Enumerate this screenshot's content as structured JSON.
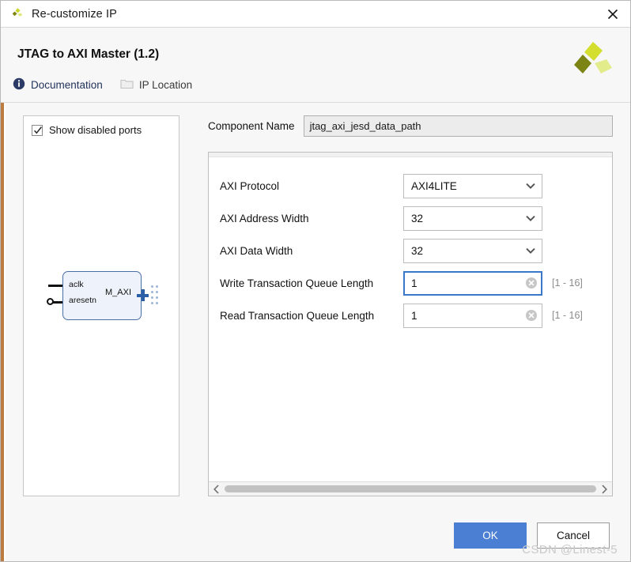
{
  "window": {
    "title": "Re-customize IP",
    "close_label": "×",
    "logo_icon": "xilinx-logo-icon"
  },
  "header": {
    "ip_title": "JTAG to AXI Master (1.2)",
    "vendor_logo_icon": "xilinx-logo-icon",
    "links": [
      {
        "label": "Documentation",
        "icon": "info-icon"
      },
      {
        "label": "IP Location",
        "icon": "folder-icon"
      }
    ]
  },
  "left_panel": {
    "show_disabled_ports": {
      "label": "Show disabled ports",
      "checked": true,
      "check_icon": "checkmark-icon"
    },
    "symbol": {
      "input_ports": [
        "aclk",
        "aresetn"
      ],
      "output_ports": [
        "M_AXI"
      ],
      "expand_icon": "plus-icon",
      "block_fill": "#eef3fb",
      "block_stroke": "#4a6fa5"
    }
  },
  "form": {
    "component_name": {
      "label": "Component Name",
      "value": "jtag_axi_jesd_data_path"
    },
    "fields": [
      {
        "label": "AXI Protocol",
        "type": "combo",
        "value": "AXI4LITE",
        "icon": "chevron-down-icon",
        "hint": "",
        "focused": false
      },
      {
        "label": "AXI Address Width",
        "type": "combo",
        "value": "32",
        "icon": "chevron-down-icon",
        "hint": "",
        "focused": false
      },
      {
        "label": "AXI Data Width",
        "type": "combo",
        "value": "32",
        "icon": "chevron-down-icon",
        "hint": "",
        "focused": false
      },
      {
        "label": "Write Transaction Queue Length",
        "type": "text",
        "value": "1",
        "icon": "clear-circle-icon",
        "hint": "[1 - 16]",
        "focused": true
      },
      {
        "label": "Read Transaction Queue Length",
        "type": "text",
        "value": "1",
        "icon": "clear-circle-icon",
        "hint": "[1 - 16]",
        "focused": false
      }
    ],
    "scrollbar": {
      "left_icon": "chevron-left-icon",
      "right_icon": "chevron-right-icon",
      "thumb_fill": "#c2c2c2"
    }
  },
  "footer": {
    "ok_label": "OK",
    "cancel_label": "Cancel",
    "ok_color": "#4a7fd4"
  },
  "watermark": {
    "text": "CSDN @Linest-5"
  }
}
